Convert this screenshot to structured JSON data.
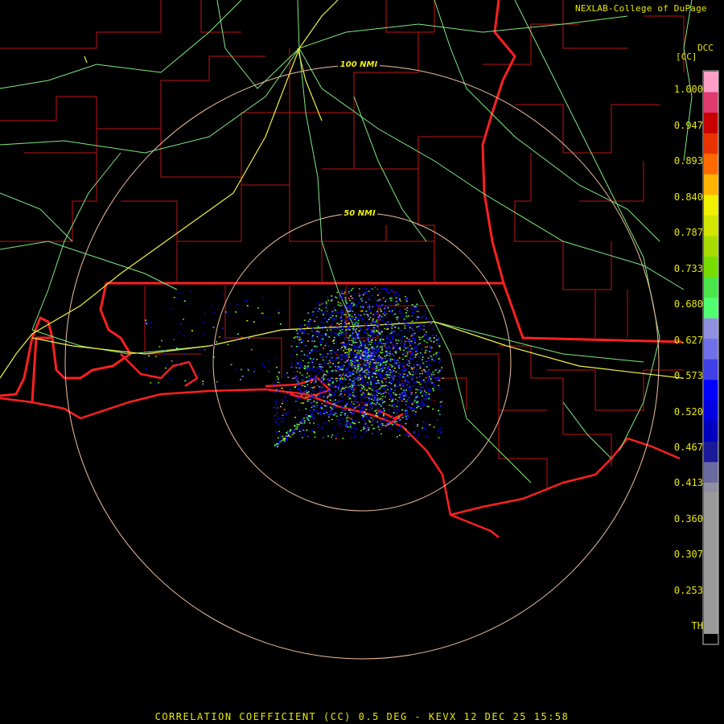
{
  "header": {
    "credit": "NEXLAB-College of DuPage",
    "station_code": "DCC",
    "units": "[CC]"
  },
  "rings": [
    {
      "label": "100 NMI"
    },
    {
      "label": "50 NMI"
    }
  ],
  "legend": {
    "ticks": [
      "1.000",
      "0.947",
      "0.893",
      "0.840",
      "0.787",
      "0.733",
      "0.680",
      "0.627",
      "0.573",
      "0.520",
      "0.467",
      "0.413",
      "0.360",
      "0.307",
      "0.253",
      "TH"
    ],
    "colors": [
      "#ff9ec6",
      "#e03a6e",
      "#c80000",
      "#e83200",
      "#ff6a00",
      "#ffb400",
      "#f0f000",
      "#d2e600",
      "#a8dc00",
      "#78dc00",
      "#4ae64a",
      "#50ff70",
      "#9090e0",
      "#7070e8",
      "#4040e8",
      "#0000ff",
      "#0000e0",
      "#0000c0",
      "#1a1a9a",
      "#6a6aa0",
      "#9090a0",
      "#9a9a9a",
      "#000000"
    ]
  },
  "footer": {
    "product": "CORRELATION COEFFICIENT (CC) 0.5 DEG - KEVX 12 DEC 25 15:58"
  },
  "colors": {
    "text": "#e8e800",
    "state_borders": "#ff2020",
    "county_lines": "#c01414",
    "highways": "#80e880",
    "interstates": "#f0f040",
    "range_rings": "#f0c0a0"
  }
}
